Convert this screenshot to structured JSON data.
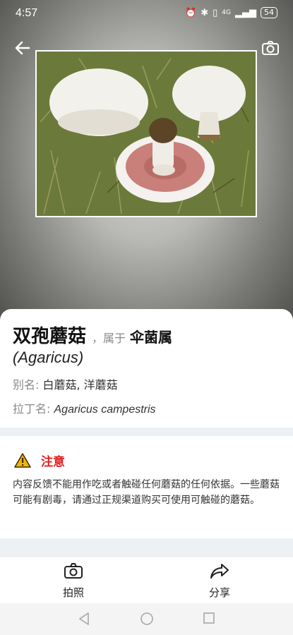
{
  "status": {
    "time": "4:57",
    "battery": "54",
    "network": "4G"
  },
  "header": {
    "back_icon": "back-arrow-icon",
    "camera_icon": "camera-icon"
  },
  "mushroom": {
    "name": "双孢蘑菇",
    "belongs_prefix": "，属于",
    "genus": "伞菌属",
    "genus_latin": "(Agaricus)",
    "alias_label": "别名:",
    "alias_value": "白蘑菇, 洋蘑菇",
    "latin_label": "拉丁名:",
    "latin_value": "Agaricus campestris"
  },
  "notice": {
    "title": "注意",
    "body": "内容反馈不能用作吃或者触碰任何蘑菇的任何依据。一些蘑菇可能有剧毒，请通过正规渠道购买可使用可触碰的蘑菇。"
  },
  "bottom_bar": {
    "photo_label": "拍照",
    "share_label": "分享"
  },
  "colors": {
    "warning_red": "#e02020",
    "divider": "#eef1f4"
  }
}
